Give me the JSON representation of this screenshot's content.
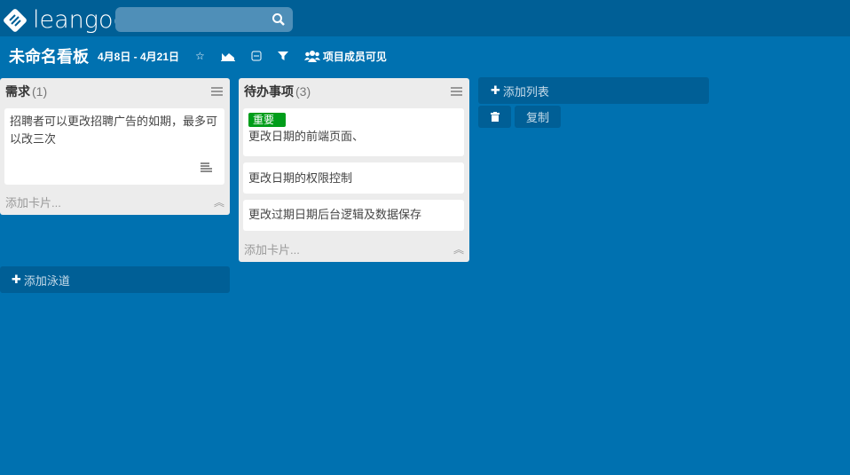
{
  "header": {
    "logo": "leangoo",
    "search_placeholder": ""
  },
  "board": {
    "title": "未命名看板",
    "dates": "4月8日 - 4月21日",
    "members_label": "项目成员可见"
  },
  "lists": [
    {
      "title": "需求",
      "count": "(1)",
      "cards": [
        {
          "text": "招聘者可以更改招聘广告的如期，最多可以改三次"
        }
      ],
      "add_card": "添加卡片..."
    },
    {
      "title": "待办事项",
      "count": "(3)",
      "cards": [
        {
          "label": "重要",
          "label_color": "#009d1a",
          "text": "更改日期的前端页面、"
        },
        {
          "text": "更改日期的权限控制"
        },
        {
          "text": "更改过期日期后台逻辑及数据保存"
        }
      ],
      "add_card": "添加卡片..."
    }
  ],
  "actions": {
    "add_list": "添加列表",
    "copy": "复制",
    "add_lane": "添加泳道"
  }
}
